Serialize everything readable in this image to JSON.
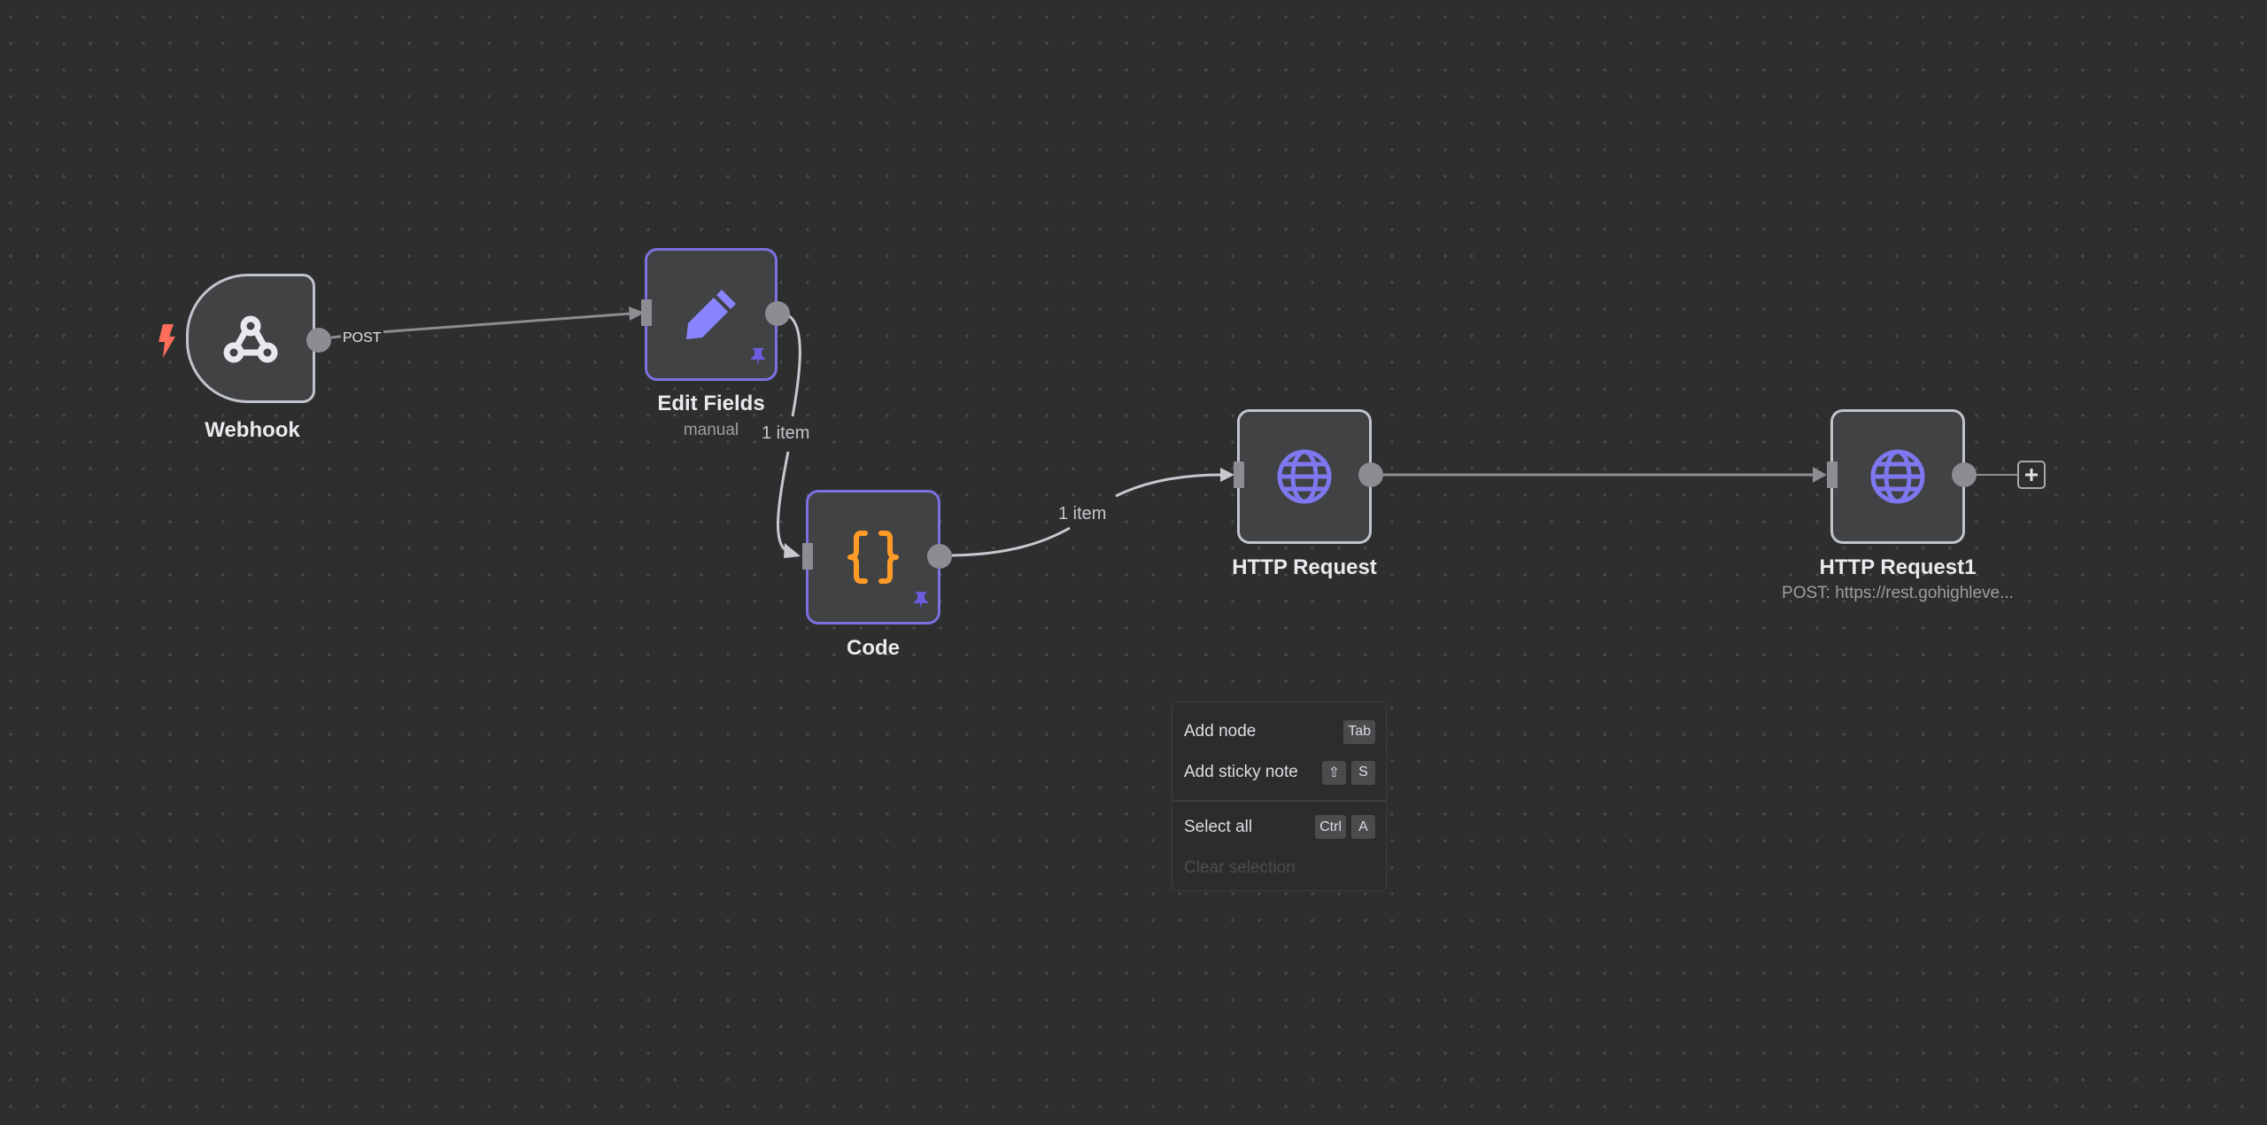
{
  "canvas": {
    "background_color": "#2d2e2e",
    "grid_dot_color": "#4a4b4c"
  },
  "colors": {
    "node_border": "#c2c4cc",
    "pinned_border": "#7d70e0",
    "node_fill": "#414244",
    "handle": "#8c8d92",
    "edge": "#8c8d92",
    "edge_with_data": "#c6c7cd",
    "trigger_bolt": "#ff6d5a",
    "code_icon": "#ff9b26",
    "accent_icon": "#7f77f0",
    "pin_icon": "#6a5de0"
  },
  "nodes": [
    {
      "id": "webhook",
      "name": "Webhook",
      "subtitle": "",
      "icon": "webhook-icon",
      "trigger": true,
      "pinned": false
    },
    {
      "id": "edit-fields",
      "name": "Edit Fields",
      "subtitle": "manual",
      "icon": "pencil-icon",
      "trigger": false,
      "pinned": true
    },
    {
      "id": "code",
      "name": "Code",
      "subtitle": "",
      "icon": "code-braces-icon",
      "trigger": false,
      "pinned": true
    },
    {
      "id": "http-request",
      "name": "HTTP Request",
      "subtitle": "",
      "icon": "globe-icon",
      "trigger": false,
      "pinned": false
    },
    {
      "id": "http-request-1",
      "name": "HTTP Request1",
      "subtitle": "POST: https://rest.gohighleve...",
      "icon": "globe-icon",
      "trigger": false,
      "pinned": false
    }
  ],
  "edges": [
    {
      "from": "webhook",
      "to": "edit-fields",
      "label": "POST"
    },
    {
      "from": "edit-fields",
      "to": "code",
      "label": "1 item"
    },
    {
      "from": "code",
      "to": "http-request",
      "label": "1 item"
    },
    {
      "from": "http-request",
      "to": "http-request-1",
      "label": ""
    }
  ],
  "add_node_button": {
    "label": "+",
    "icon": "plus-icon"
  },
  "context_menu": {
    "items": [
      {
        "label": "Add node",
        "shortcut": [
          "Tab"
        ],
        "disabled": false
      },
      {
        "label": "Add sticky note",
        "shortcut": [
          "⇧",
          "S"
        ],
        "disabled": false
      },
      {
        "label": "Select all",
        "shortcut": [
          "Ctrl",
          "A"
        ],
        "disabled": false
      },
      {
        "label": "Clear selection",
        "shortcut": [],
        "disabled": true
      }
    ]
  }
}
